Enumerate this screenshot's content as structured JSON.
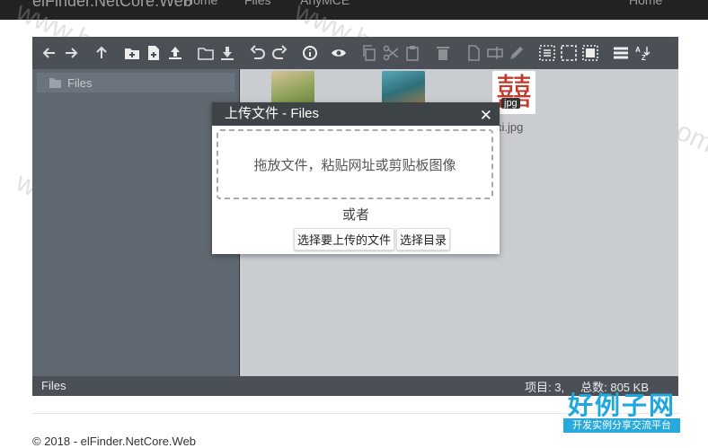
{
  "topnav": {
    "brand": "elFinder.NetCore.Web",
    "items": [
      "Home",
      "Files",
      "AnyMCE"
    ],
    "right_item": "Home"
  },
  "toolbar": {
    "icons": [
      "back-icon",
      "forward-icon",
      "up-icon",
      "new-folder-icon",
      "new-file-icon",
      "upload-icon",
      "open-icon",
      "download-icon",
      "undo-icon",
      "redo-icon",
      "info-icon",
      "preview-icon",
      "copy-icon",
      "cut-icon",
      "paste-icon",
      "delete-icon",
      "duplicate-icon",
      "rename-icon",
      "edit-icon",
      "select-all-icon",
      "select-none-icon",
      "select-invert-icon",
      "list-view-icon",
      "sort-icon"
    ]
  },
  "sidebar": {
    "root_label": "Files"
  },
  "files": [
    {
      "name": "",
      "thumb_colors": [
        "#c4a574",
        "#6e8a4a"
      ]
    },
    {
      "name": "",
      "thumb_colors": [
        "#3d8a9a",
        "#b57a3a"
      ]
    },
    {
      "name": "xi.jpg",
      "badge": "jpg",
      "glyph": "囍",
      "thumb_colors": [
        "#ffffff",
        "#c0392b"
      ]
    }
  ],
  "statusbar": {
    "path": "Files",
    "summary": "项目: 3,     总数: 805 KB"
  },
  "upload_dialog": {
    "title": "上传文件 - Files",
    "close_glyph": "✕",
    "dropzone_text": "拖放文件，粘贴网址或剪贴板图像",
    "or_text": "或者",
    "select_files_label": "选择要上传的文件",
    "select_folder_label": "选择目录"
  },
  "footer": {
    "text": "© 2018 - elFinder.NetCore.Web"
  },
  "watermark": {
    "text": "www.haolizi.com"
  },
  "logo": {
    "title": "好例子网",
    "subtitle": "开发实例分享交流平台"
  },
  "colors": {
    "toolbar": "#4b5057",
    "sidebar": "#5f6770",
    "workzone": "#c9ccd1",
    "dialog_title": "#3e4348",
    "logo_blue": "#1fa8e0"
  }
}
